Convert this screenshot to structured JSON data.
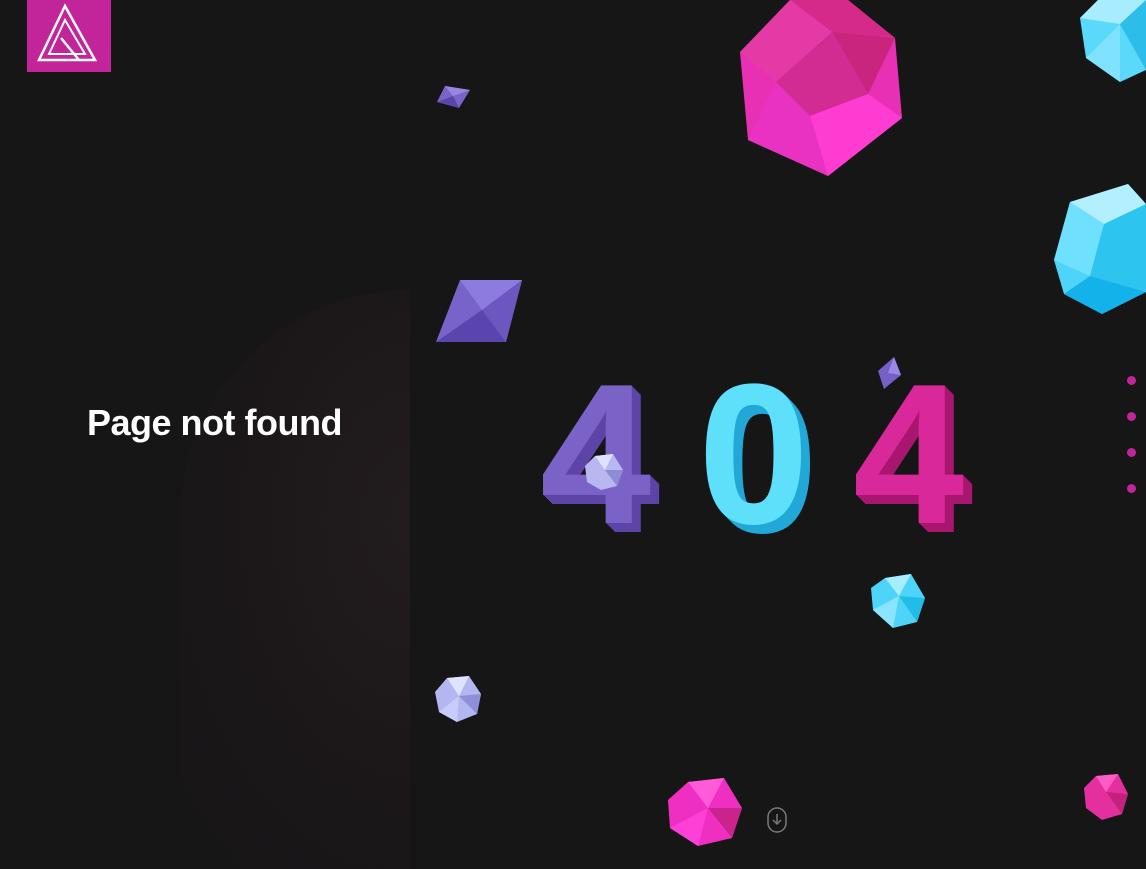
{
  "brand": {
    "logo_icon": "brand-triangle-logo",
    "logo_color": "#c2249a"
  },
  "header": {
    "menu_icon": "hamburger-menu-icon"
  },
  "main": {
    "title": "Page not found",
    "error_digits": [
      {
        "char": "4",
        "color": "#7b62c7",
        "shadow": "#5c45a6"
      },
      {
        "char": "0",
        "color": "#5ee0fb",
        "shadow": "#22a8d6"
      },
      {
        "char": "4",
        "color": "#d8289a",
        "shadow": "#a81670"
      }
    ]
  },
  "section_nav": {
    "count": 4,
    "color": "#c2249a"
  },
  "scroll": {
    "icon": "scroll-down-mouse-icon"
  },
  "colors": {
    "background": "#161616",
    "magenta": "#e82bb0",
    "cyan": "#5ad9fb",
    "purple": "#7560c8"
  }
}
